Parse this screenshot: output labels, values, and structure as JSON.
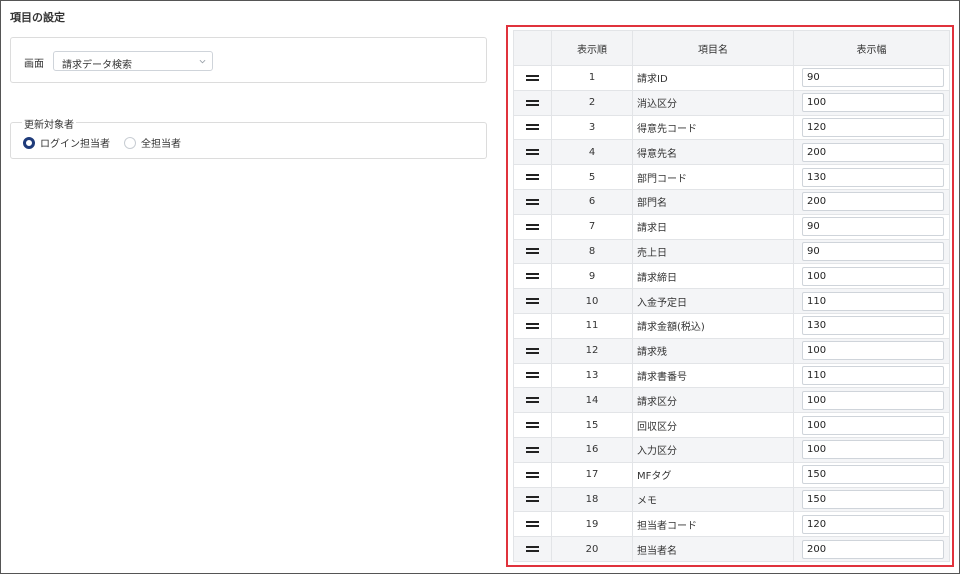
{
  "page": {
    "title": "項目の設定"
  },
  "screen": {
    "label": "画面",
    "selected": "請求データ検索"
  },
  "target": {
    "legend": "更新対象者",
    "options": [
      {
        "label": "ログイン担当者",
        "checked": true
      },
      {
        "label": "全担当者",
        "checked": false
      }
    ]
  },
  "grid": {
    "headers": {
      "order": "表示順",
      "name": "項目名",
      "width": "表示幅"
    },
    "rows": [
      {
        "order": "1",
        "name": "請求ID",
        "width": "90"
      },
      {
        "order": "2",
        "name": "消込区分",
        "width": "100"
      },
      {
        "order": "3",
        "name": "得意先コード",
        "width": "120"
      },
      {
        "order": "4",
        "name": "得意先名",
        "width": "200"
      },
      {
        "order": "5",
        "name": "部門コード",
        "width": "130"
      },
      {
        "order": "6",
        "name": "部門名",
        "width": "200"
      },
      {
        "order": "7",
        "name": "請求日",
        "width": "90"
      },
      {
        "order": "8",
        "name": "売上日",
        "width": "90"
      },
      {
        "order": "9",
        "name": "請求締日",
        "width": "100"
      },
      {
        "order": "10",
        "name": "入金予定日",
        "width": "110"
      },
      {
        "order": "11",
        "name": "請求金額(税込)",
        "width": "130"
      },
      {
        "order": "12",
        "name": "請求残",
        "width": "100"
      },
      {
        "order": "13",
        "name": "請求書番号",
        "width": "110"
      },
      {
        "order": "14",
        "name": "請求区分",
        "width": "100"
      },
      {
        "order": "15",
        "name": "回収区分",
        "width": "100"
      },
      {
        "order": "16",
        "name": "入力区分",
        "width": "100"
      },
      {
        "order": "17",
        "name": "MFタグ",
        "width": "150"
      },
      {
        "order": "18",
        "name": "メモ",
        "width": "150"
      },
      {
        "order": "19",
        "name": "担当者コード",
        "width": "120"
      },
      {
        "order": "20",
        "name": "担当者名",
        "width": "200"
      }
    ]
  },
  "colors": {
    "highlight": "#e0323c",
    "radio_checked": "#1f3b7a"
  }
}
